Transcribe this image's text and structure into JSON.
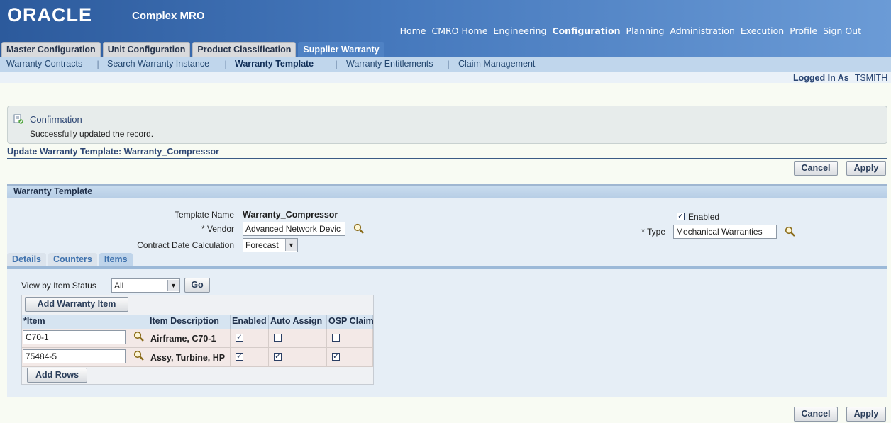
{
  "header": {
    "logo": "ORACLE",
    "app_name": "Complex MRO"
  },
  "global_nav": [
    "Home",
    "CMRO Home",
    "Engineering",
    "Configuration",
    "Planning",
    "Administration",
    "Execution",
    "Profile",
    "Sign Out"
  ],
  "global_nav_active": "Configuration",
  "tabs": [
    "Master Configuration",
    "Unit Configuration",
    "Product Classification",
    "Supplier Warranty"
  ],
  "tabs_active": "Supplier Warranty",
  "subnav": {
    "items": [
      "Warranty Contracts",
      "Search Warranty Instance",
      "Warranty Template",
      "Warranty Entitlements",
      "Claim Management"
    ],
    "active": "Warranty Template"
  },
  "user": {
    "label": "Logged In As",
    "name": "TSMITH"
  },
  "confirmation": {
    "title": "Confirmation",
    "message": "Successfully updated the record."
  },
  "page_title": "Update Warranty Template: Warranty_Compressor",
  "buttons": {
    "cancel": "Cancel",
    "apply": "Apply",
    "go": "Go",
    "add_warranty_item": "Add Warranty Item",
    "add_rows": "Add Rows"
  },
  "section_title": "Warranty Template",
  "form": {
    "template_name_label": "Template Name",
    "template_name": "Warranty_Compressor",
    "vendor_label": "* Vendor",
    "vendor": "Advanced Network Devic",
    "contract_date_label": "Contract Date Calculation",
    "contract_date": "Forecast",
    "enabled_label": "Enabled",
    "enabled": true,
    "type_label": "* Type",
    "type": "Mechanical Warranties"
  },
  "subtabs": [
    "Details",
    "Counters",
    "Items"
  ],
  "subtabs_active": "Items",
  "items_filter": {
    "label": "View by Item Status",
    "value": "All"
  },
  "items_table": {
    "columns": [
      "*Item",
      "Item Description",
      "Enabled",
      "Auto Assign",
      "OSP Claim"
    ],
    "rows": [
      {
        "item": "C70-1",
        "description": "Airframe, C70-1",
        "enabled": true,
        "auto_assign": false,
        "osp_claim": false
      },
      {
        "item": "75484-5",
        "description": "Assy, Turbine, HP",
        "enabled": true,
        "auto_assign": true,
        "osp_claim": true
      }
    ]
  },
  "icons": [
    "search-icon",
    "confirmation-icon",
    "dropdown-arrow-icon",
    "checkbox-icon"
  ]
}
